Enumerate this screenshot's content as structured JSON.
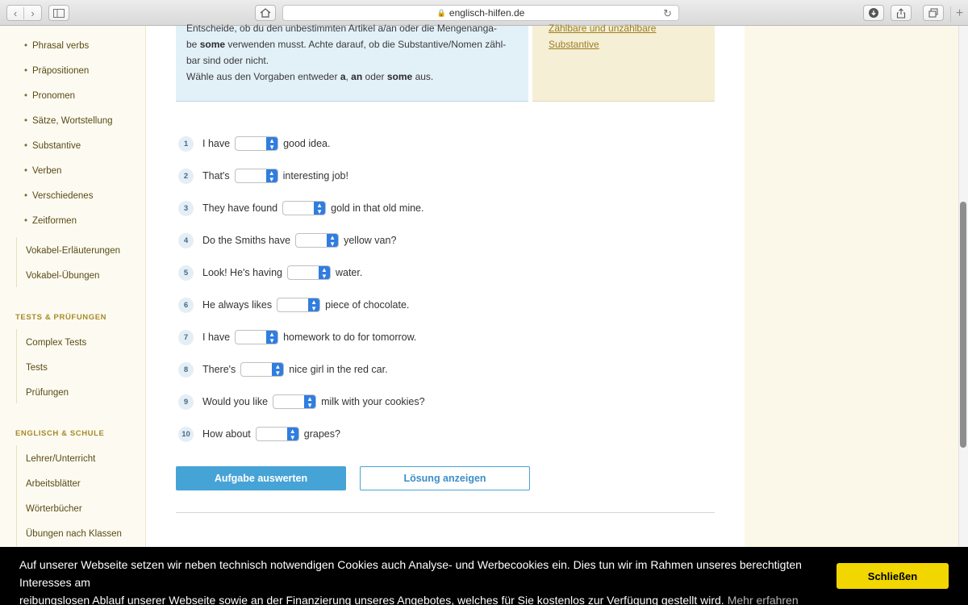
{
  "browser": {
    "url": "englisch-hilfen.de",
    "icons": [
      "back-icon",
      "forward-icon",
      "sidebar-icon",
      "home-icon",
      "lock-icon",
      "reload-icon",
      "download-icon",
      "share-icon",
      "tabs-icon",
      "new-tab-icon"
    ]
  },
  "sidebar": {
    "items": [
      {
        "label": "Phrasal verbs"
      },
      {
        "label": "Präpositionen"
      },
      {
        "label": "Pronomen"
      },
      {
        "label": "Sätze, Wortstellung"
      },
      {
        "label": "Substantive"
      },
      {
        "label": "Verben"
      },
      {
        "label": "Verschiedenes"
      },
      {
        "label": "Zeitformen"
      }
    ],
    "vokabel": [
      {
        "label": "Vokabel-Erläuterungen"
      },
      {
        "label": "Vokabel-Übungen"
      }
    ],
    "tests_title": "TESTS & PRÜFUNGEN",
    "tests": [
      {
        "label": "Complex Tests"
      },
      {
        "label": "Tests"
      },
      {
        "label": "Prüfungen"
      }
    ],
    "schule_title": "ENGLISCH & SCHULE",
    "schule": [
      {
        "label": "Lehrer/Unterricht"
      },
      {
        "label": "Arbeitsblätter"
      },
      {
        "label": "Wörterbücher"
      },
      {
        "label": "Übungen nach Klassen"
      }
    ]
  },
  "instructions": {
    "line1": "Entscheide, ob du den unbestimmten Artikel a/an oder die Mengenanga-",
    "line2_pre": "be ",
    "line2_bold": "some",
    "line2_post": " verwenden musst. Achte darauf, ob die Substantive/Nomen zähl-",
    "line3": "bar sind oder nicht.",
    "line4_pre": "Wähle aus den Vorgaben entweder ",
    "opt_a": "a",
    "comma": ", ",
    "opt_an": "an",
    "oder": " oder ",
    "opt_some": "some",
    "line4_post": " aus."
  },
  "side_links": {
    "line1": "Zählbare und unzählbare",
    "line2": "Substantive"
  },
  "questions": [
    {
      "num": "1",
      "before": "I have",
      "after": "good idea."
    },
    {
      "num": "2",
      "before": "That's",
      "after": "interesting job!"
    },
    {
      "num": "3",
      "before": "They have found",
      "after": "gold in that old mine."
    },
    {
      "num": "4",
      "before": "Do the Smiths have",
      "after": "yellow van?"
    },
    {
      "num": "5",
      "before": "Look! He's having",
      "after": "water."
    },
    {
      "num": "6",
      "before": "He always likes",
      "after": "piece of chocolate."
    },
    {
      "num": "7",
      "before": "I have",
      "after": "homework to do for tomorrow."
    },
    {
      "num": "8",
      "before": "There's",
      "after": "nice girl in the red car."
    },
    {
      "num": "9",
      "before": "Would you like",
      "after": "milk with your cookies?"
    },
    {
      "num": "10",
      "before": "How about",
      "after": "grapes?"
    }
  ],
  "buttons": {
    "evaluate": "Aufgabe auswerten",
    "solution": "Lösung anzeigen"
  },
  "cookie": {
    "text_line1": "Auf unserer Webseite setzen wir neben technisch notwendigen Cookies auch Analyse- und Werbecookies ein. Dies tun wir im Rahmen unseres berechtigten Interesses am",
    "text_line2": "reibungslosen Ablauf unserer Webseite sowie an der Finanzierung unseres Angebotes, welches für Sie kostenlos zur Verfügung gestellt wird.",
    "more": "Mehr erfahren",
    "close": "Schließen"
  },
  "colors": {
    "accent_blue": "#46a3d6",
    "select_blue": "#2f7de1",
    "sidebar_gold": "#a68a2a",
    "cookie_yellow": "#f1d600"
  }
}
